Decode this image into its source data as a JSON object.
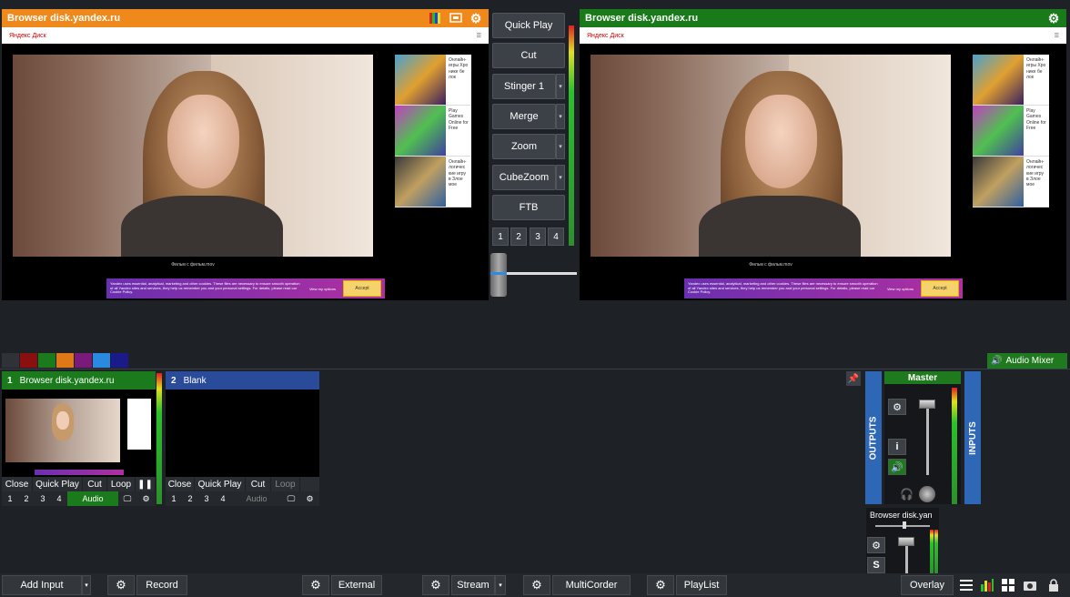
{
  "preview": {
    "title": "Browser disk.yandex.ru",
    "header_color": "#f0891c",
    "browser_logo": "Яндекс Диск",
    "video_caption": "Фильм с фильм.mov",
    "cookie_text": "Yandex uses essential, analytical, marketing and other cookies. These files are necessary to ensure smooth operation of all Yandex sites and services, they help us remember you and your personal settings. For details, please read our Cookie Policy.",
    "cookie_view": "View my options",
    "cookie_accept": "Accept",
    "ads": [
      {
        "text": "Онлайн-игры Хро нике бе лок"
      },
      {
        "text": "Play Games Online for Free"
      },
      {
        "text": "Онлайн-логичес кие игру в Злое мое"
      }
    ]
  },
  "output": {
    "title": "Browser disk.yandex.ru",
    "header_color": "#187a18",
    "browser_logo": "Яндекс Диск",
    "video_caption": "Фильм с фильм.mov",
    "cookie_text": "Yandex uses essential, analytical, marketing and other cookies. These files are necessary to ensure smooth operation of all Yandex sites and services, they help us remember you and your personal settings. For details, please read our Cookie Policy.",
    "cookie_view": "View my options",
    "cookie_accept": "Accept",
    "ads": [
      {
        "text": "Онлайн-игры Хро нике бе лок"
      },
      {
        "text": "Play Games Online for Free"
      },
      {
        "text": "Онлайн-логичес кие игру в Злое мое"
      }
    ]
  },
  "transitions": {
    "quick_play": "Quick Play",
    "cut": "Cut",
    "stinger": "Stinger 1",
    "merge": "Merge",
    "zoom": "Zoom",
    "cubezoom": "CubeZoom",
    "ftb": "FTB",
    "numbers": [
      "1",
      "2",
      "3",
      "4"
    ]
  },
  "color_tags": [
    "#8a1010",
    "#1b7a1b",
    "#e07818",
    "#7a1a7a",
    "#2a8ae0",
    "#1a1a8a"
  ],
  "audio_mixer_label": "Audio Mixer",
  "inputs": [
    {
      "number": "1",
      "name": "Browser disk.yandex.ru",
      "header_color": "#1b7a1b",
      "buttons": [
        "Close",
        "Quick Play",
        "Cut",
        "Loop"
      ],
      "nums": [
        "1",
        "2",
        "3",
        "4"
      ],
      "audio": "Audio"
    },
    {
      "number": "2",
      "name": "Blank",
      "header_color": "#2a4a9a",
      "buttons": [
        "Close",
        "Quick Play",
        "Cut",
        "Loop"
      ],
      "nums": [
        "1",
        "2",
        "3",
        "4"
      ],
      "audio": "Audio"
    }
  ],
  "mixer": {
    "master": "Master",
    "outputs": "OUTPUTS",
    "inputs": "INPUTS",
    "channel_name": "Browser disk.yan",
    "info": "i",
    "solo": "S"
  },
  "toolbar": {
    "add_input": "Add Input",
    "record": "Record",
    "external": "External",
    "stream": "Stream",
    "multicorder": "MultiCorder",
    "playlist": "PlayList",
    "overlay": "Overlay"
  }
}
